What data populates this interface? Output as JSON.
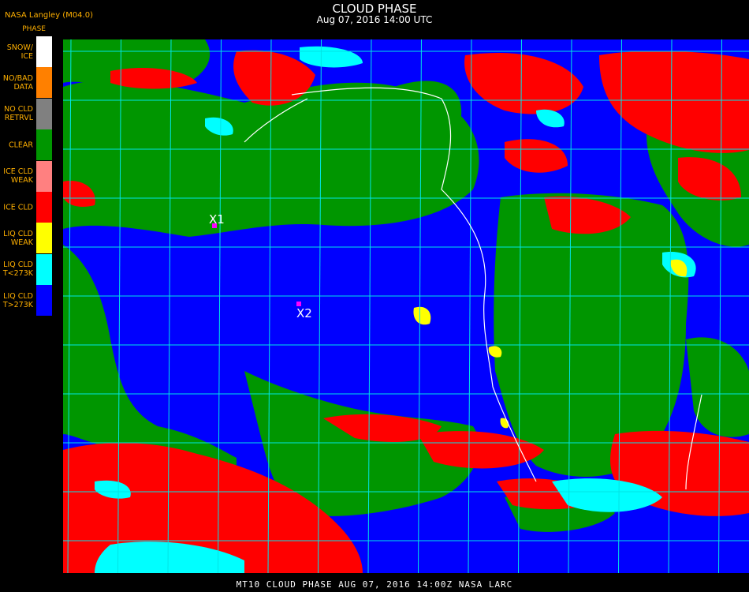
{
  "header": {
    "credit": "NASA Langley (M04.0)",
    "title": "CLOUD PHASE",
    "subtitle": "Aug 07, 2016 14:00 UTC"
  },
  "legend": {
    "title": "PHASE",
    "items": [
      {
        "label": "SNOW/\nICE",
        "color": "#ffffff"
      },
      {
        "label": "NO/BAD\nDATA",
        "color": "#ff8000"
      },
      {
        "label": "NO CLD\nRETRVL",
        "color": "#808080"
      },
      {
        "label": "CLEAR",
        "color": "#009600"
      },
      {
        "label": "ICE CLD\nWEAK",
        "color": "#ff8080"
      },
      {
        "label": "ICE CLD",
        "color": "#ff0000"
      },
      {
        "label": "LIQ CLD\nWEAK",
        "color": "#ffff00"
      },
      {
        "label": "LIQ CLD\nT<273K",
        "color": "#00ffff"
      },
      {
        "label": "LIQ CLD\nT>273K",
        "color": "#0000ff"
      }
    ]
  },
  "markers": [
    {
      "label": "X1",
      "color": "#ff00ff"
    },
    {
      "label": "X2",
      "color": "#ff00ff"
    }
  ],
  "map_colors": {
    "grid": "#00e5e5",
    "coast": "#ffffff"
  },
  "footer": "MT10  CLOUD PHASE   AUG 07, 2016 14:00Z   NASA LARC"
}
